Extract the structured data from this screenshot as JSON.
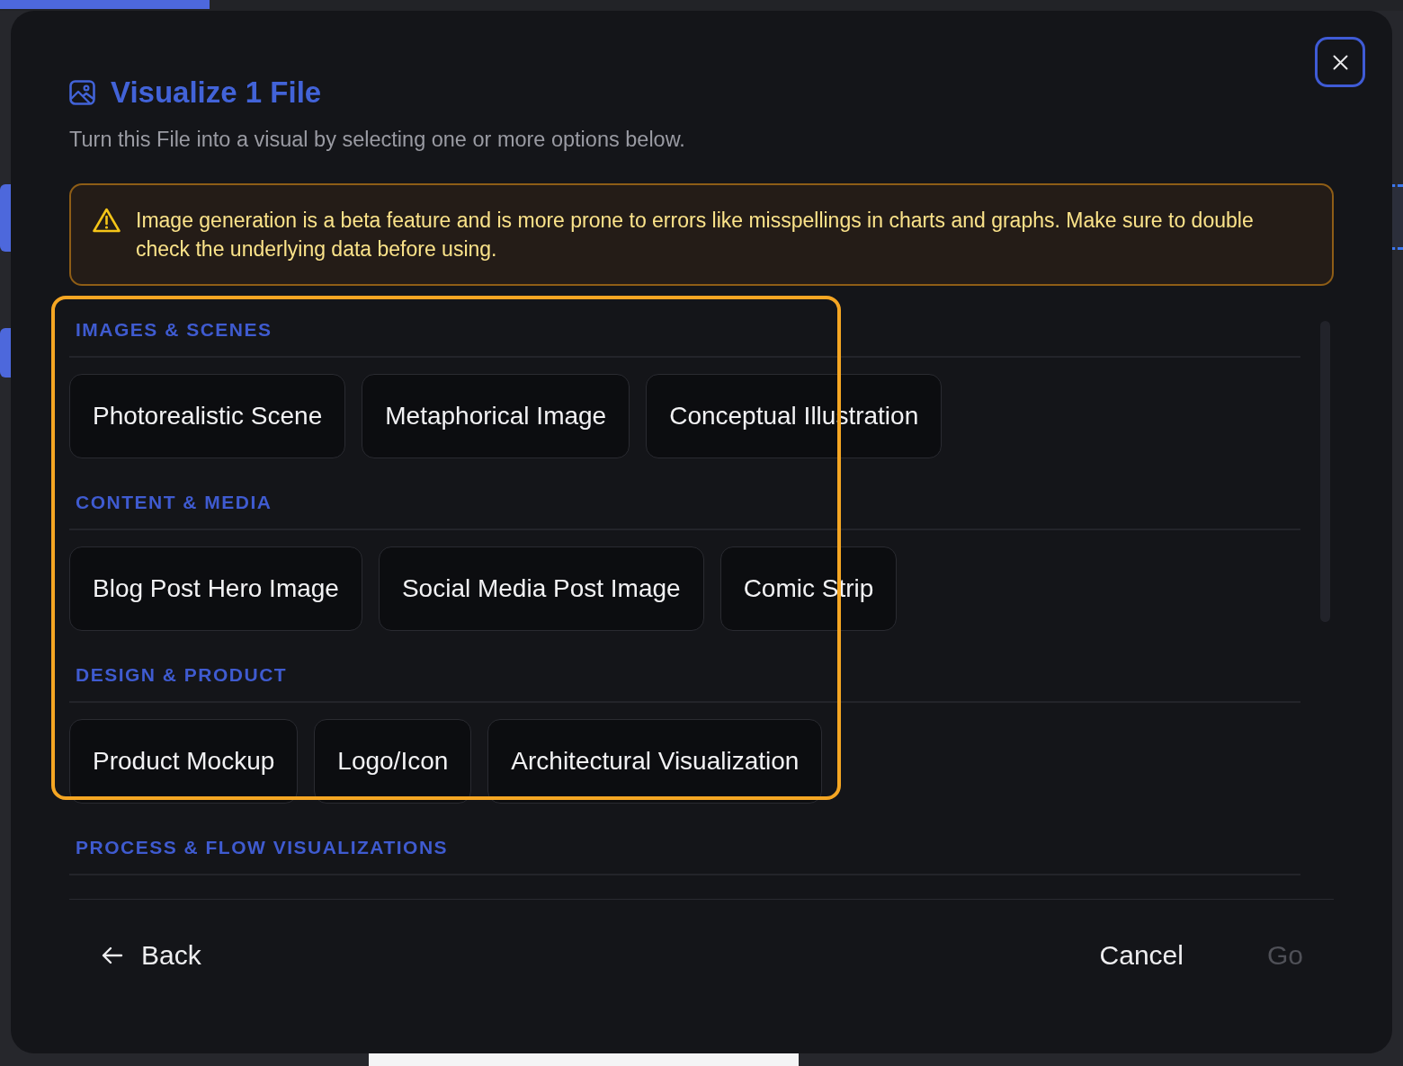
{
  "dialog": {
    "title": "Visualize 1 File",
    "subtitle": "Turn this File into a visual by selecting one or more options below."
  },
  "warning": {
    "text": "Image generation is a beta feature and is more prone to errors like misspellings in charts and graphs. Make sure to double check the underlying data before using."
  },
  "sections": [
    {
      "heading": "IMAGES & SCENES",
      "highlighted": true,
      "options": [
        {
          "label": "Photorealistic Scene",
          "selected": false
        },
        {
          "label": "Metaphorical Image",
          "selected": false
        },
        {
          "label": "Conceptual Illustration",
          "selected": false
        }
      ]
    },
    {
      "heading": "CONTENT & MEDIA",
      "highlighted": true,
      "options": [
        {
          "label": "Blog Post Hero Image",
          "selected": false
        },
        {
          "label": "Social Media Post Image",
          "selected": false
        },
        {
          "label": "Comic Strip",
          "selected": false
        }
      ]
    },
    {
      "heading": "DESIGN & PRODUCT",
      "highlighted": true,
      "options": [
        {
          "label": "Product Mockup",
          "selected": false
        },
        {
          "label": "Logo/Icon",
          "selected": false
        },
        {
          "label": "Architectural Visualization",
          "selected": false
        }
      ]
    },
    {
      "heading": "PROCESS & FLOW VISUALIZATIONS",
      "highlighted": false
    }
  ],
  "footer": {
    "back": "Back",
    "cancel": "Cancel",
    "go": {
      "label": "Go",
      "disabled": true
    }
  }
}
